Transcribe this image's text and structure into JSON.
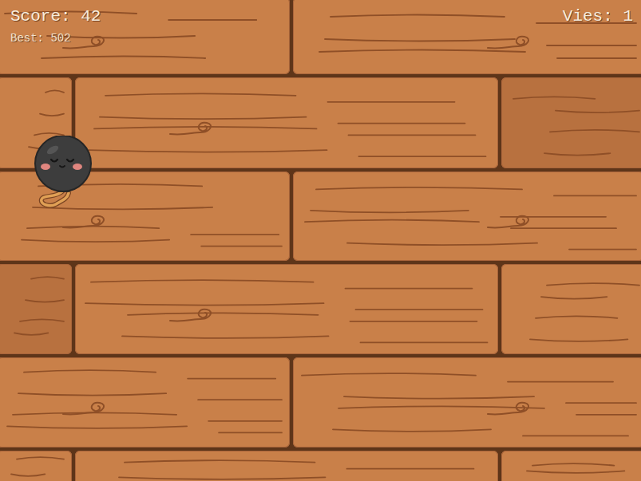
{
  "hud": {
    "score": "Score: 42",
    "best": "Best: 502",
    "lives": "Vies: 1"
  }
}
